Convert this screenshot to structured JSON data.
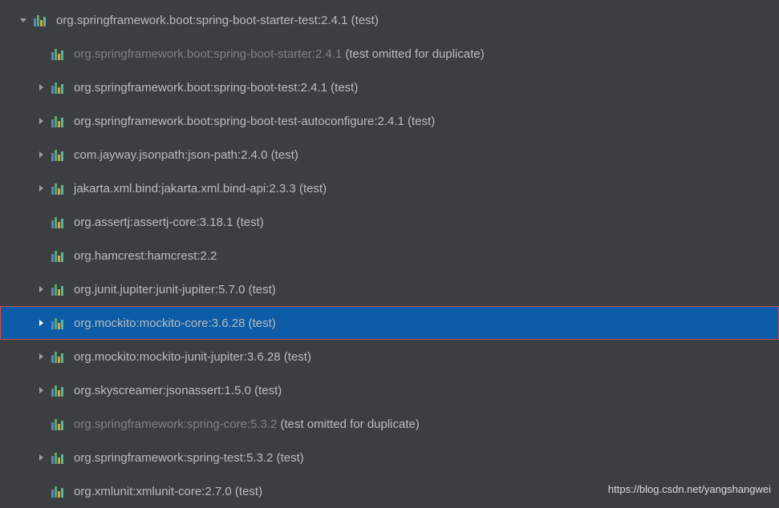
{
  "watermark": "https://blog.csdn.net/yangshangwei",
  "tree": [
    {
      "level": 0,
      "arrow": "down",
      "dim": false,
      "selected": false,
      "boxed": false,
      "label": "org.springframework.boot:spring-boot-starter-test:2.4.1 (test)",
      "suffix": ""
    },
    {
      "level": 1,
      "arrow": "none",
      "dim": true,
      "selected": false,
      "boxed": false,
      "label": "org.springframework.boot:spring-boot-starter:2.4.1",
      "suffix": "(test omitted for duplicate)"
    },
    {
      "level": 1,
      "arrow": "right",
      "dim": false,
      "selected": false,
      "boxed": false,
      "label": "org.springframework.boot:spring-boot-test:2.4.1 (test)",
      "suffix": ""
    },
    {
      "level": 1,
      "arrow": "right",
      "dim": false,
      "selected": false,
      "boxed": false,
      "label": "org.springframework.boot:spring-boot-test-autoconfigure:2.4.1 (test)",
      "suffix": ""
    },
    {
      "level": 1,
      "arrow": "right",
      "dim": false,
      "selected": false,
      "boxed": false,
      "label": "com.jayway.jsonpath:json-path:2.4.0 (test)",
      "suffix": ""
    },
    {
      "level": 1,
      "arrow": "right",
      "dim": false,
      "selected": false,
      "boxed": false,
      "label": "jakarta.xml.bind:jakarta.xml.bind-api:2.3.3 (test)",
      "suffix": ""
    },
    {
      "level": 1,
      "arrow": "none",
      "dim": false,
      "selected": false,
      "boxed": false,
      "label": "org.assertj:assertj-core:3.18.1 (test)",
      "suffix": ""
    },
    {
      "level": 1,
      "arrow": "none",
      "dim": false,
      "selected": false,
      "boxed": false,
      "label": "org.hamcrest:hamcrest:2.2",
      "suffix": ""
    },
    {
      "level": 1,
      "arrow": "right",
      "dim": false,
      "selected": false,
      "boxed": false,
      "label": "org.junit.jupiter:junit-jupiter:5.7.0 (test)",
      "suffix": ""
    },
    {
      "level": 1,
      "arrow": "right",
      "dim": false,
      "selected": true,
      "boxed": true,
      "label": "org.mockito:mockito-core:3.6.28 (test)",
      "suffix": ""
    },
    {
      "level": 1,
      "arrow": "right",
      "dim": false,
      "selected": false,
      "boxed": false,
      "label": "org.mockito:mockito-junit-jupiter:3.6.28 (test)",
      "suffix": ""
    },
    {
      "level": 1,
      "arrow": "right",
      "dim": false,
      "selected": false,
      "boxed": false,
      "label": "org.skyscreamer:jsonassert:1.5.0 (test)",
      "suffix": ""
    },
    {
      "level": 1,
      "arrow": "none",
      "dim": true,
      "selected": false,
      "boxed": false,
      "label": "org.springframework:spring-core:5.3.2",
      "suffix": "(test omitted for duplicate)"
    },
    {
      "level": 1,
      "arrow": "right",
      "dim": false,
      "selected": false,
      "boxed": false,
      "label": "org.springframework:spring-test:5.3.2 (test)",
      "suffix": ""
    },
    {
      "level": 1,
      "arrow": "none",
      "dim": false,
      "selected": false,
      "boxed": false,
      "label": "org.xmlunit:xmlunit-core:2.7.0 (test)",
      "suffix": ""
    }
  ]
}
